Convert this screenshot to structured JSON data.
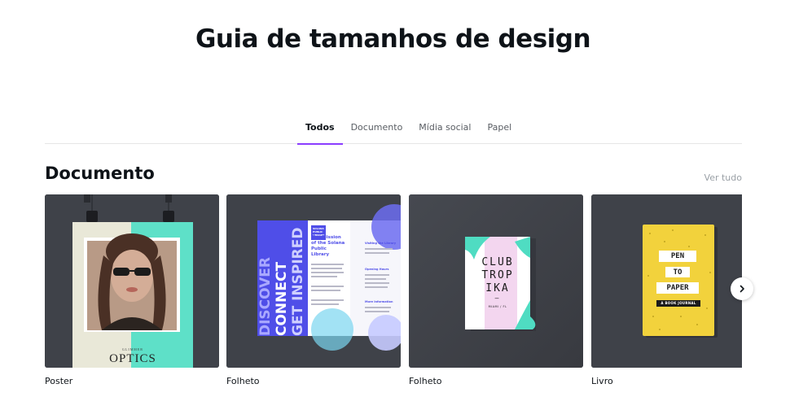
{
  "page": {
    "title": "Guia de tamanhos de design"
  },
  "tabs": [
    {
      "label": "Todos",
      "active": true
    },
    {
      "label": "Documento",
      "active": false
    },
    {
      "label": "Mídia social",
      "active": false
    },
    {
      "label": "Papel",
      "active": false
    }
  ],
  "section": {
    "title": "Documento",
    "see_all": "Ver tudo"
  },
  "cards": [
    {
      "label": "Poster",
      "art": {
        "brand_small": "GLIMMER",
        "brand": "OPTICS"
      }
    },
    {
      "label": "Folheto",
      "art": {
        "library": "SOLANA PUBLIC LIBRARY",
        "spine_words": [
          "DISCOVER",
          "CONNECT",
          "GET INSPIRED"
        ],
        "mission_title": "The Mission of the Solana Public Library",
        "visiting": "Visiting the Library",
        "hours": "Opening Hours",
        "more_info": "More Information"
      }
    },
    {
      "label": "Folheto",
      "art": {
        "line1": "CLUB",
        "line2": "TROP",
        "line3": "IKA",
        "dash": "—",
        "location": "MIAMI / FL"
      }
    },
    {
      "label": "Livro",
      "art": {
        "line1": "PEN",
        "line2": "TO",
        "line3": "PAPER",
        "subtitle": "A BOOK JOURNAL"
      }
    }
  ],
  "colors": {
    "accent": "#8b3dff",
    "thumb_bg": "#3f4249",
    "mint": "#5ee0c8",
    "brochure_blue": "#4f4ee8",
    "yellow": "#f2d23c"
  }
}
